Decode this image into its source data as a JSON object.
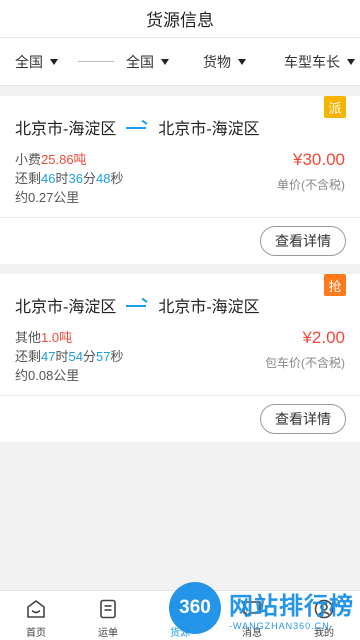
{
  "header": {
    "title": "货源信息"
  },
  "filters": [
    {
      "label": "全国"
    },
    {
      "label": "全国"
    },
    {
      "label": "货物"
    },
    {
      "label": "车型车长"
    }
  ],
  "cards": [
    {
      "badge": "派",
      "from": "北京市-海淀区",
      "to": "北京市-海淀区",
      "cargo_prefix": "小费",
      "cargo_value": "25.86吨",
      "remain_prefix": "还剩",
      "remain_h": "46",
      "remain_h_unit": "时",
      "remain_m": "36",
      "remain_m_unit": "分",
      "remain_s": "48",
      "remain_s_unit": "秒",
      "distance": "约0.27公里",
      "price": "¥30.00",
      "price_unit": "单价(不含税)",
      "button": "查看详情"
    },
    {
      "badge": "抢",
      "from": "北京市-海淀区",
      "to": "北京市-海淀区",
      "cargo_prefix": "其他",
      "cargo_value": "1.0吨",
      "remain_prefix": "还剩",
      "remain_h": "47",
      "remain_h_unit": "时",
      "remain_m": "54",
      "remain_m_unit": "分",
      "remain_s": "57",
      "remain_s_unit": "秒",
      "distance": "约0.08公里",
      "price": "¥2.00",
      "price_unit": "包车价(不含税)",
      "button": "查看详情"
    }
  ],
  "tabbar": [
    {
      "label": "首页",
      "icon": "home-smile-icon"
    },
    {
      "label": "运单",
      "icon": "waybill-icon"
    },
    {
      "label": "货源",
      "icon": "cargo-icon",
      "active": true
    },
    {
      "label": "消息",
      "icon": "message-icon"
    },
    {
      "label": "我的",
      "icon": "user-icon"
    }
  ],
  "watermark": {
    "logo": "360",
    "main": "网站排行榜",
    "sub": "-WANGZHAN360.CN-"
  },
  "colors": {
    "accent_blue": "#1aa0e8",
    "price_red": "#f04a3a",
    "badge_pai": "#f5b400",
    "badge_qiang": "#ff7a1a"
  }
}
